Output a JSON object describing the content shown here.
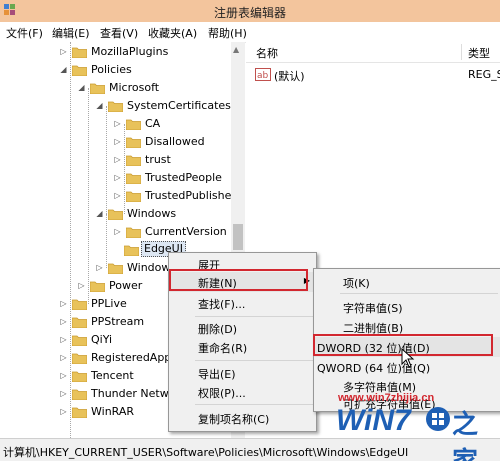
{
  "window": {
    "title": "注册表编辑器"
  },
  "menubar": {
    "items": [
      "文件(F)",
      "编辑(E)",
      "查看(V)",
      "收藏夹(A)",
      "帮助(H)"
    ]
  },
  "tree": {
    "nodes": [
      {
        "label": "MozillaPlugins"
      },
      {
        "label": "Policies"
      },
      {
        "label": "Microsoft"
      },
      {
        "label": "SystemCertificates"
      },
      {
        "label": "CA"
      },
      {
        "label": "Disallowed"
      },
      {
        "label": "trust"
      },
      {
        "label": "TrustedPeople"
      },
      {
        "label": "TrustedPublisher"
      },
      {
        "label": "Windows"
      },
      {
        "label": "CurrentVersion"
      },
      {
        "label": "EdgeUI"
      },
      {
        "label": "Windows"
      },
      {
        "label": "Power"
      },
      {
        "label": "PPLive"
      },
      {
        "label": "PPStream"
      },
      {
        "label": "QiYi"
      },
      {
        "label": "RegisteredApp"
      },
      {
        "label": "Tencent"
      },
      {
        "label": "Thunder Netwo"
      },
      {
        "label": "WinRAR"
      }
    ]
  },
  "list": {
    "columns": [
      "名称",
      "类型"
    ],
    "rows": [
      {
        "name": "(默认)",
        "type": "REG_S"
      }
    ]
  },
  "context_menu": {
    "items": [
      "展开",
      "新建(N)",
      "查找(F)...",
      "删除(D)",
      "重命名(R)",
      "导出(E)",
      "权限(P)...",
      "复制项名称(C)"
    ]
  },
  "submenu": {
    "items": [
      "项(K)",
      "字符串值(S)",
      "二进制值(B)",
      "DWORD (32 位)值(D)",
      "QWORD (64 位)值(Q)",
      "多字符串值(M)",
      "可扩充字符串值(E)"
    ]
  },
  "statusbar": {
    "path": "计算机\\HKEY_CURRENT_USER\\Software\\Policies\\Microsoft\\Windows\\EdgeUI"
  },
  "watermark": {
    "site": "www.win7zhijia.cn",
    "brand": "WiN7",
    "suffix": "之家"
  },
  "colors": {
    "titlebar": "#f3c59d",
    "highlight": "#d2272f",
    "folder": "#e8c25a"
  }
}
